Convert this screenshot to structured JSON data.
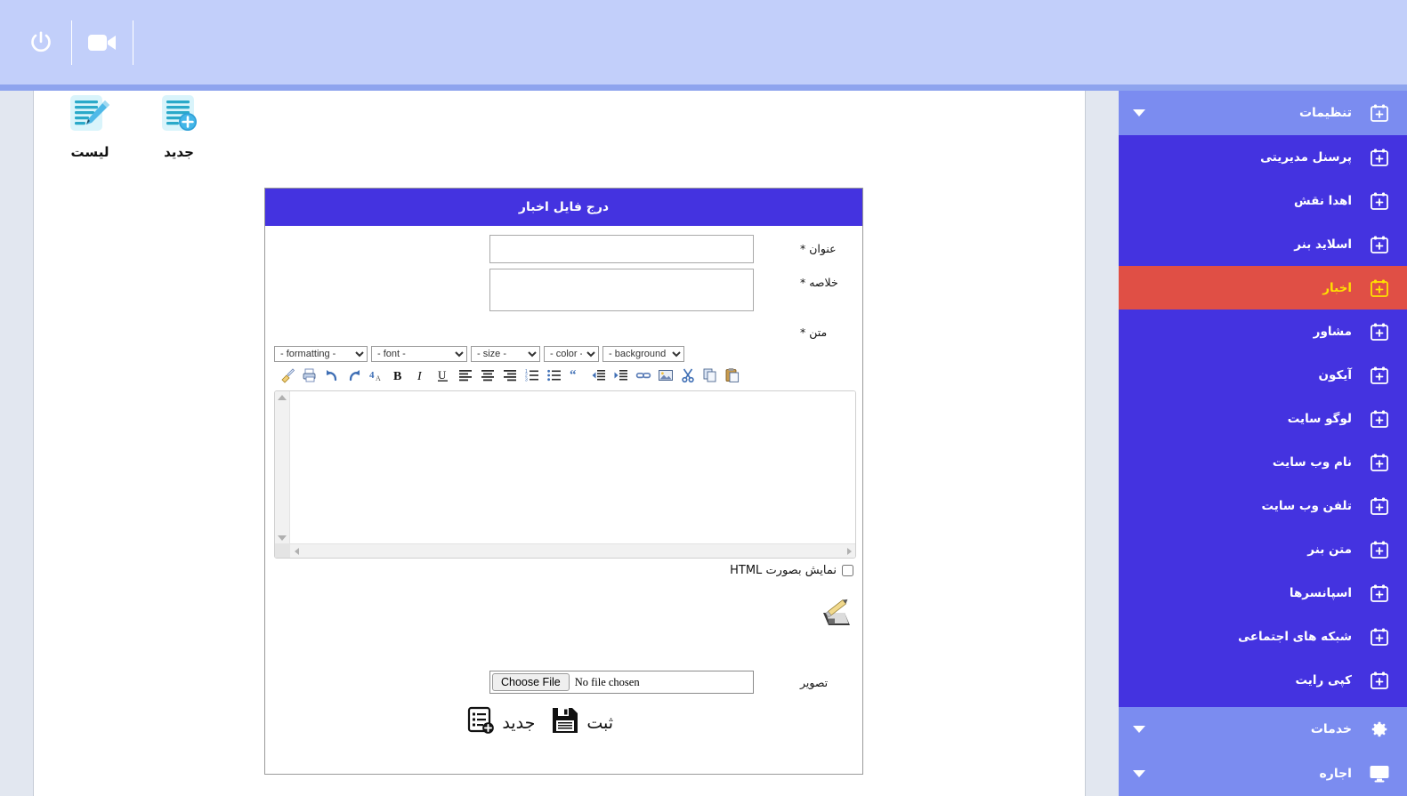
{
  "topbar": {
    "power_icon": "power-icon",
    "video_icon": "video-camera-icon"
  },
  "shortcuts": [
    {
      "id": "new",
      "label": "جدید",
      "icon": "document-add-icon"
    },
    {
      "id": "list",
      "label": "لیست",
      "icon": "document-edit-icon"
    }
  ],
  "panel": {
    "title": "درج فایل اخبار",
    "fields": {
      "title_label": "عنوان *",
      "title_value": "",
      "summary_label": "خلاصه *",
      "summary_value": "",
      "body_label": "متن *",
      "image_label": "تصویر"
    },
    "editor": {
      "selects": [
        {
          "id": "formatting",
          "selected": "- formatting -"
        },
        {
          "id": "font",
          "selected": "- font -"
        },
        {
          "id": "size",
          "selected": "- size -"
        },
        {
          "id": "color",
          "selected": "- color -"
        },
        {
          "id": "background",
          "selected": "- background -"
        }
      ],
      "tools": [
        "clean-formatting-icon",
        "print-icon",
        "undo-icon",
        "redo-icon",
        "spellcheck-icon",
        "bold-icon",
        "italic-icon",
        "underline-icon",
        "align-left-icon",
        "align-center-icon",
        "align-right-icon",
        "ordered-list-icon",
        "unordered-list-icon",
        "blockquote-icon",
        "outdent-icon",
        "indent-icon",
        "link-icon",
        "insert-image-icon",
        "cut-icon",
        "copy-icon",
        "paste-icon"
      ],
      "content": "",
      "html_checkbox_label": "نمایش بصورت HTML",
      "html_checkbox_checked": false,
      "save_icon": "save-edit-icon"
    },
    "file": {
      "button_label": "Choose File",
      "status_text": "No file chosen"
    },
    "actions": [
      {
        "id": "submit",
        "label": "ثبت",
        "icon": "floppy-save-icon"
      },
      {
        "id": "new",
        "label": "جدید",
        "icon": "list-add-icon"
      }
    ]
  },
  "sidebar": {
    "groups": [
      {
        "id": "settings",
        "label": "تنظیمات",
        "icon": "calendar-plus-icon",
        "expanded": true,
        "items": [
          {
            "id": "management-personnel",
            "label": "پرسنل مدیریتی",
            "icon": "calendar-plus-icon",
            "active": false
          },
          {
            "id": "role-grant",
            "label": "اهدا نقش",
            "icon": "calendar-plus-icon",
            "active": false
          },
          {
            "id": "banner-slide",
            "label": "اسلاید بنر",
            "icon": "calendar-plus-icon",
            "active": false
          },
          {
            "id": "news",
            "label": "اخبار",
            "icon": "calendar-plus-icon",
            "active": true
          },
          {
            "id": "advisor",
            "label": "مشاور",
            "icon": "calendar-plus-icon",
            "active": false
          },
          {
            "id": "icon",
            "label": "آیکون",
            "icon": "calendar-plus-icon",
            "active": false
          },
          {
            "id": "site-logo",
            "label": "لوگو سایت",
            "icon": "calendar-plus-icon",
            "active": false
          },
          {
            "id": "site-name",
            "label": "نام وب سایت",
            "icon": "calendar-plus-icon",
            "active": false
          },
          {
            "id": "site-phone",
            "label": "تلفن وب سایت",
            "icon": "calendar-plus-icon",
            "active": false
          },
          {
            "id": "banner-text",
            "label": "متن بنر",
            "icon": "calendar-plus-icon",
            "active": false
          },
          {
            "id": "sponsors",
            "label": "اسپانسرها",
            "icon": "calendar-plus-icon",
            "active": false
          },
          {
            "id": "social-networks",
            "label": "شبکه های اجتماعی",
            "icon": "calendar-plus-icon",
            "active": false
          },
          {
            "id": "copyright",
            "label": "کپی رایت",
            "icon": "calendar-plus-icon",
            "active": false
          }
        ]
      }
    ],
    "bottom_groups": [
      {
        "id": "services",
        "label": "خدمات",
        "icon": "gear-icon",
        "expanded": false
      },
      {
        "id": "rent",
        "label": "اجاره",
        "icon": "monitor-icon",
        "expanded": false
      }
    ]
  },
  "colors": {
    "topbar": "#c2cffa",
    "topbar_underline": "#8ea4ee",
    "sidebar": "#4433e0",
    "sidebar_header": "#7b8cf0",
    "active_item": "#e04f45",
    "active_text": "#ffe000",
    "panel_header": "#4433e0",
    "rail": "#e2e7f0"
  }
}
